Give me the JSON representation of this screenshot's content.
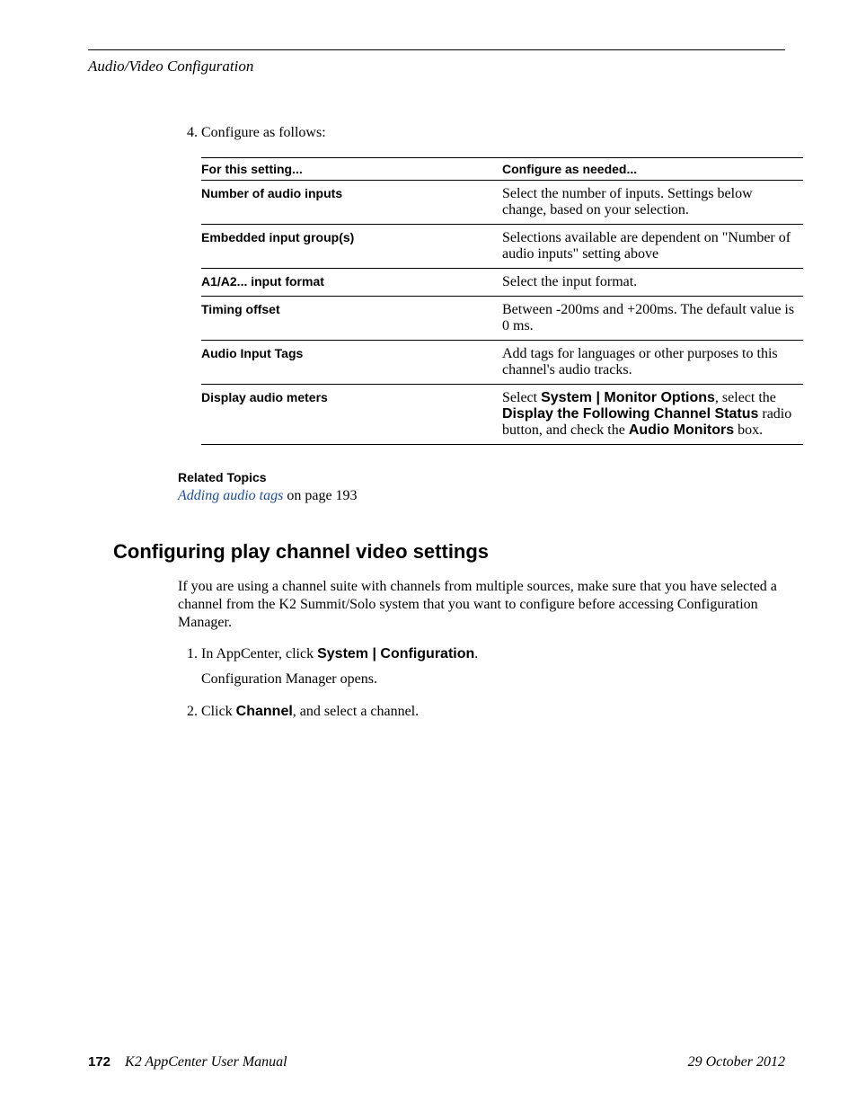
{
  "header": {
    "running_head": "Audio/Video Configuration"
  },
  "step4": {
    "number": "4.",
    "text": "Configure as follows:"
  },
  "table": {
    "head": {
      "col1": "For this setting...",
      "col2": "Configure as needed..."
    },
    "rows": [
      {
        "setting": "Number of audio inputs",
        "config": "Select the number of inputs. Settings below change, based on your selection."
      },
      {
        "setting": "Embedded input group(s)",
        "config": "Selections available are dependent on \"Number of audio inputs\" setting above"
      },
      {
        "setting": "A1/A2... input format",
        "config": "Select the input format."
      },
      {
        "setting": "Timing offset",
        "config": "Between -200ms and +200ms. The default value is 0 ms."
      },
      {
        "setting": "Audio Input Tags",
        "config": "Add tags for languages or other purposes to this channel's audio tracks."
      }
    ],
    "row_display_meters": {
      "setting": "Display audio meters",
      "prefix": "Select ",
      "bold1": "System | Monitor Options",
      "mid1": ", select the ",
      "bold2": "Display the Following Channel Status",
      "mid2": " radio button, and check the ",
      "bold3": "Audio Monitors",
      "suffix": " box."
    }
  },
  "related": {
    "title": "Related Topics",
    "link_text": "Adding audio tags",
    "rest": " on page 193"
  },
  "section2": {
    "title": "Configuring play channel video settings",
    "intro": "If you are using a channel suite with channels from multiple sources, make sure that you have selected a channel from the K2 Summit/Solo system that you want to configure before accessing Configuration Manager.",
    "step1": {
      "number": "1.",
      "pre": "In AppCenter, click ",
      "bold": "System | Configuration",
      "post": ".",
      "result": "Configuration Manager opens."
    },
    "step2": {
      "number": "2.",
      "pre": "Click ",
      "bold": "Channel",
      "post": ", and select a channel."
    }
  },
  "footer": {
    "page": "172",
    "manual": "K2 AppCenter User Manual",
    "date": "29 October 2012"
  }
}
